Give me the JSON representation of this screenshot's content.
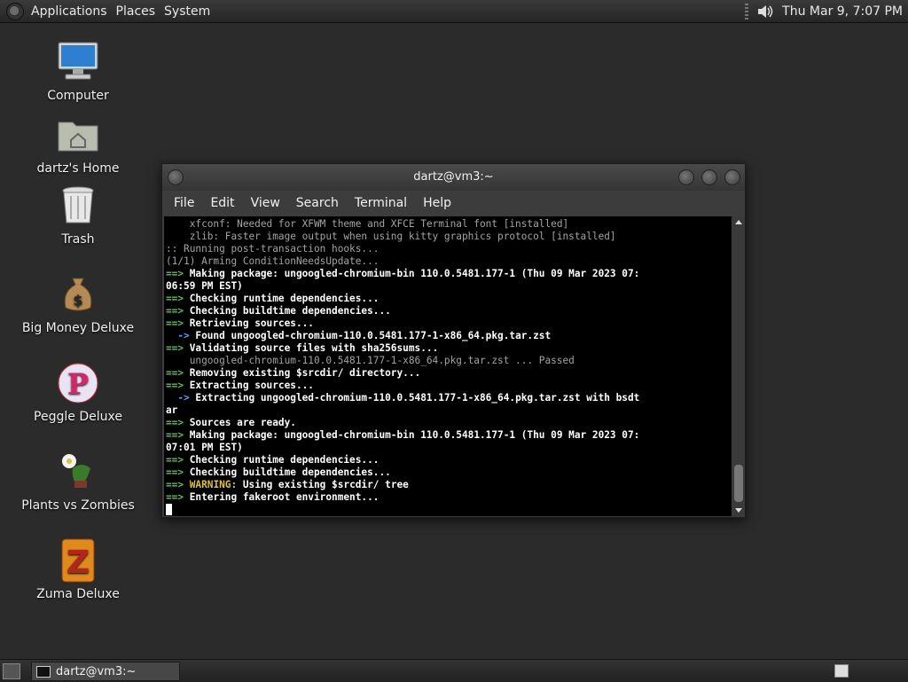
{
  "top_panel": {
    "menus": [
      "Applications",
      "Places",
      "System"
    ],
    "clock": "Thu Mar  9,  7:07 PM"
  },
  "desktop_icons": [
    {
      "label": "Computer",
      "icon": "computer-icon"
    },
    {
      "label": "dartz's Home",
      "icon": "home-folder-icon"
    },
    {
      "label": "Trash",
      "icon": "trash-icon"
    },
    {
      "label": "Big Money Deluxe",
      "icon": "money-bag-icon"
    },
    {
      "label": "Peggle Deluxe",
      "icon": "peggle-icon"
    },
    {
      "label": "Plants vs Zombies",
      "icon": "plants-vs-zombies-icon"
    },
    {
      "label": "Zuma Deluxe",
      "icon": "zuma-icon"
    }
  ],
  "terminal": {
    "title": "dartz@vm3:~",
    "menu": [
      "File",
      "Edit",
      "View",
      "Search",
      "Terminal",
      "Help"
    ],
    "lines": [
      {
        "cls": "l-gray",
        "prefix": "",
        "text": "    xfconf: Needed for XFWM theme and XFCE Terminal font [installed]"
      },
      {
        "cls": "l-gray",
        "prefix": "",
        "text": "    zlib: Faster image output when using kitty graphics protocol [installed]"
      },
      {
        "cls": "l-gray",
        "prefix": "",
        "text": ":: Running post-transaction hooks..."
      },
      {
        "cls": "l-gray",
        "prefix": "",
        "text": "(1/1) Arming ConditionNeedsUpdate..."
      },
      {
        "cls": "bwhite",
        "prefix": "==>",
        "text": " Making package: ungoogled-chromium-bin 110.0.5481.177-1 (Thu 09 Mar 2023 07:"
      },
      {
        "cls": "bwhite",
        "prefix": "",
        "text": "06:59 PM EST)"
      },
      {
        "cls": "bwhite",
        "prefix": "==>",
        "text": " Checking runtime dependencies..."
      },
      {
        "cls": "bwhite",
        "prefix": "==>",
        "text": " Checking buildtime dependencies..."
      },
      {
        "cls": "bwhite",
        "prefix": "==>",
        "text": " Retrieving sources..."
      },
      {
        "cls": "bwhite",
        "prefix": "  ->",
        "text": " Found ungoogled-chromium-110.0.5481.177-1-x86_64.pkg.tar.zst",
        "sub": true
      },
      {
        "cls": "bwhite",
        "prefix": "==>",
        "text": " Validating source files with sha256sums..."
      },
      {
        "cls": "l-gray",
        "prefix": "",
        "text": "    ungoogled-chromium-110.0.5481.177-1-x86_64.pkg.tar.zst ... Passed"
      },
      {
        "cls": "bwhite",
        "prefix": "==>",
        "text": " Removing existing $srcdir/ directory..."
      },
      {
        "cls": "bwhite",
        "prefix": "==>",
        "text": " Extracting sources..."
      },
      {
        "cls": "bwhite",
        "prefix": "  ->",
        "text": " Extracting ungoogled-chromium-110.0.5481.177-1-x86_64.pkg.tar.zst with bsdt",
        "sub": true
      },
      {
        "cls": "bwhite",
        "prefix": "",
        "text": "ar"
      },
      {
        "cls": "bwhite",
        "prefix": "==>",
        "text": " Sources are ready."
      },
      {
        "cls": "bwhite",
        "prefix": "==>",
        "text": " Making package: ungoogled-chromium-bin 110.0.5481.177-1 (Thu 09 Mar 2023 07:"
      },
      {
        "cls": "bwhite",
        "prefix": "",
        "text": "07:01 PM EST)"
      },
      {
        "cls": "bwhite",
        "prefix": "==>",
        "text": " Checking runtime dependencies..."
      },
      {
        "cls": "bwhite",
        "prefix": "==>",
        "text": " Checking buildtime dependencies..."
      },
      {
        "cls": "warn",
        "prefix": "==>",
        "text": " WARNING:",
        "rest": " Using existing $srcdir/ tree"
      },
      {
        "cls": "bwhite",
        "prefix": "==>",
        "text": " Entering fakeroot environment..."
      }
    ]
  },
  "taskbar": {
    "window_button": "dartz@vm3:~"
  }
}
